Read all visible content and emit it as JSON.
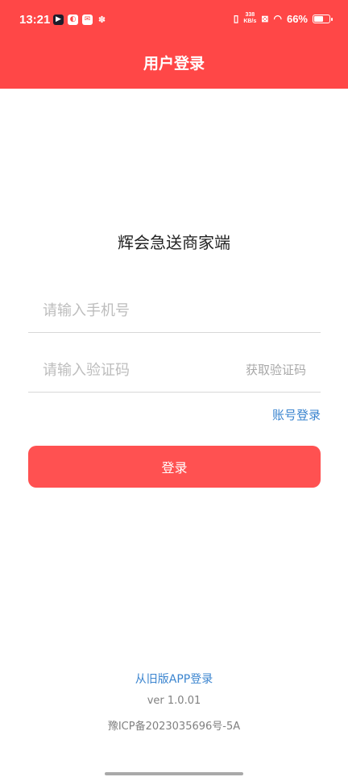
{
  "status_bar": {
    "time": "13:21",
    "net_speed_value": "338",
    "net_speed_unit": "KB/s",
    "battery_text": "66%",
    "battery_level": 0.66
  },
  "header": {
    "title": "用户登录",
    "background_color": "#ff4747"
  },
  "app": {
    "name": "辉会急送商家端"
  },
  "form": {
    "phone_placeholder": "请输入手机号",
    "phone_value": "",
    "code_placeholder": "请输入验证码",
    "code_value": "",
    "get_code_label": "获取验证码",
    "account_login_label": "账号登录",
    "login_button_label": "登录",
    "accent_color": "#ff5151",
    "link_color": "#3a84cf"
  },
  "footer": {
    "old_app_link": "从旧版APP登录",
    "version": "ver 1.0.01",
    "icp": "豫ICP备2023035696号-5A"
  }
}
